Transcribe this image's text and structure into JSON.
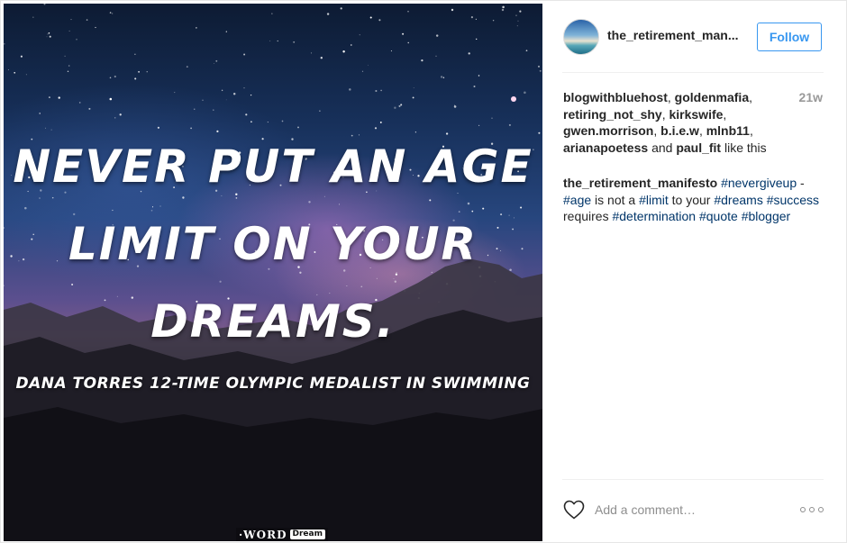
{
  "post": {
    "image": {
      "quote_lines": [
        "NEVER PUT AN AGE",
        "LIMIT ON YOUR",
        "DREAMS."
      ],
      "attribution": "DANA TORRES  12-TIME OLYMPIC MEDALIST IN SWIMMING",
      "watermark_word": "·WORD",
      "watermark_dream": "Dream"
    },
    "header": {
      "username": "the_retirement_man...",
      "follow_label": "Follow"
    },
    "likes": {
      "users": [
        "blogwithbluehost",
        "goldenmafia",
        "retiring_not_shy",
        "kirkswife",
        "gwen.morrison",
        "b.i.e.w",
        "mlnb11",
        "arianapoetess",
        "paul_fit"
      ],
      "and": "and",
      "suffix": "like this"
    },
    "age": "21w",
    "caption": {
      "author": "the_retirement_manifesto",
      "tokens": [
        {
          "text": "#nevergiveup",
          "tag": true
        },
        {
          "text": " -",
          "tag": false
        },
        {
          "text": "#age",
          "tag": true
        },
        {
          "text": " is not a ",
          "tag": false
        },
        {
          "text": "#limit",
          "tag": true
        },
        {
          "text": " to your ",
          "tag": false
        },
        {
          "text": "#dreams",
          "tag": true
        },
        {
          "text": " ",
          "tag": false
        },
        {
          "text": "#success",
          "tag": true
        },
        {
          "text": " requires ",
          "tag": false
        },
        {
          "text": "#determination",
          "tag": true
        },
        {
          "text": " ",
          "tag": false
        },
        {
          "text": "#quote",
          "tag": true
        },
        {
          "text": " ",
          "tag": false
        },
        {
          "text": "#blogger",
          "tag": true
        }
      ]
    },
    "footer": {
      "comment_placeholder": "Add a comment…",
      "heart_icon": "heart-outline-icon",
      "more_icon": "more-options-icon"
    },
    "colors": {
      "link_blue": "#3897f0",
      "hashtag": "#003569",
      "muted": "#999999"
    }
  }
}
